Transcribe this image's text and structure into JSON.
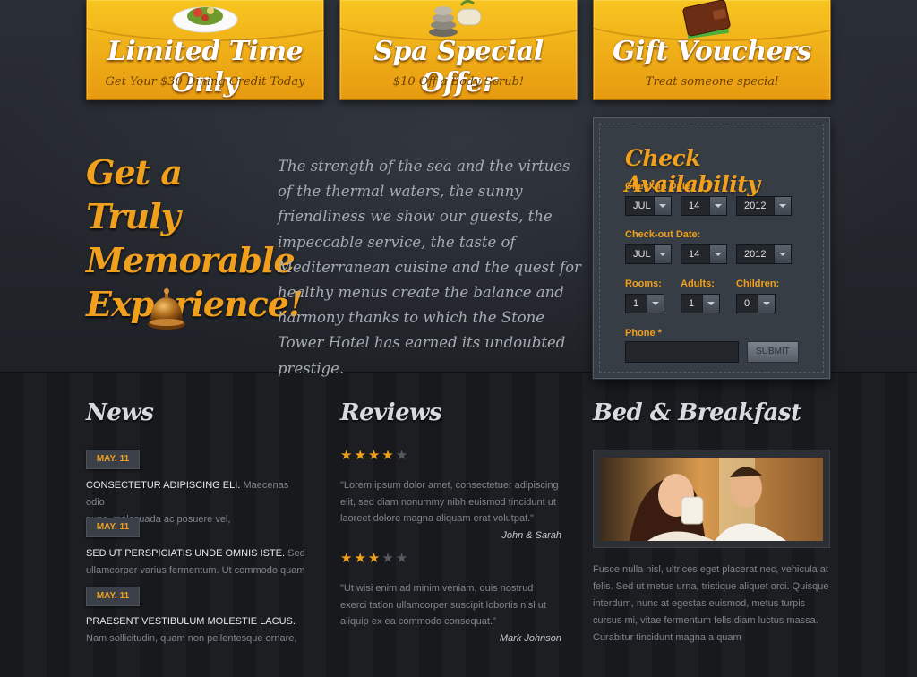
{
  "promos": [
    {
      "title": "Limited Time Only",
      "subtitle": "Get Your $30 Dining Credit Today",
      "icon": "salad-plate-icon"
    },
    {
      "title": "Spa Special Offer",
      "subtitle": "$10 Off a Body Scrub!",
      "icon": "spa-stones-icon"
    },
    {
      "title": "Gift Vouchers",
      "subtitle": "Treat someone special",
      "icon": "wallet-icon"
    }
  ],
  "hero": {
    "headline_line1": "Get a Truly",
    "headline_line2": "Memorable",
    "headline_line3": "Experience!",
    "intro": "The strength of the sea and the virtues of the thermal waters, the sunny friendliness we show our guests, the impeccable service, the taste of Mediterranean cuisine and the quest for healthy menus create the balance and harmony thanks to which the Stone Tower Hotel has earned its undoubted prestige.",
    "bell_icon": "service-bell-icon"
  },
  "availability": {
    "title": "Check Availability",
    "checkin_label": "Check-in Date:",
    "checkin": {
      "month": "JUL",
      "day": "14",
      "year": "2012"
    },
    "checkout_label": "Check-out Date:",
    "checkout": {
      "month": "JUL",
      "day": "14",
      "year": "2012"
    },
    "rooms_label": "Rooms:",
    "rooms": "1",
    "adults_label": "Adults:",
    "adults": "1",
    "children_label": "Children:",
    "children": "0",
    "phone_label": "Phone *",
    "phone_value": "",
    "submit_label": "SUBMIT"
  },
  "news": {
    "title": "News",
    "items": [
      {
        "date": "MAY. 11",
        "headline": "CONSECTETUR ADIPISCING ELI.",
        "body_first": "Maecenas odio",
        "body_second": "nunc, malesuada ac posuere vel,"
      },
      {
        "date": "MAY. 11",
        "headline": "SED UT PERSPICIATIS UNDE OMNIS ISTE.",
        "body_first": "Sed",
        "body_second": "ullamcorper varius fermentum. Ut commodo quam"
      },
      {
        "date": "MAY. 11",
        "headline": "PRAESENT VESTIBULUM MOLESTIE LACUS.",
        "body_first": "",
        "body_second": "Nam sollicitudin, quam non pellentesque ornare,"
      }
    ]
  },
  "reviews": {
    "title": "Reviews",
    "items": [
      {
        "rating": 4.5,
        "text": "\"Lorem ipsum dolor amet, consectetuer adipiscing elit, sed diam nonummy nibh euismod tincidunt ut laoreet dolore magna aliquam erat volutpat.\"",
        "author": "John & Sarah"
      },
      {
        "rating": 3.5,
        "text": "\"Ut wisi enim ad minim veniam, quis nostrud exerci tation ullamcorper suscipit lobortis nisl ut aliquip ex ea commodo consequat.\"",
        "author": "Mark Johnson"
      }
    ]
  },
  "bb": {
    "title": "Bed & Breakfast",
    "photo_icon": "couple-breakfast-photo",
    "text": "Fusce nulla nisl, ultrices eget placerat nec, vehicula at felis. Sed ut metus urna, tristique aliquet orci. Quisque interdum, nunc at egestas euismod, metus turpis cursus mi, vitae fermentum felis diam luctus massa. Curabitur tincidunt magna a quam"
  },
  "colors": {
    "accent": "#f0a01c",
    "promo_top": "#f8c520",
    "promo_bottom": "#e79a10",
    "bg": "#1b1d21"
  }
}
